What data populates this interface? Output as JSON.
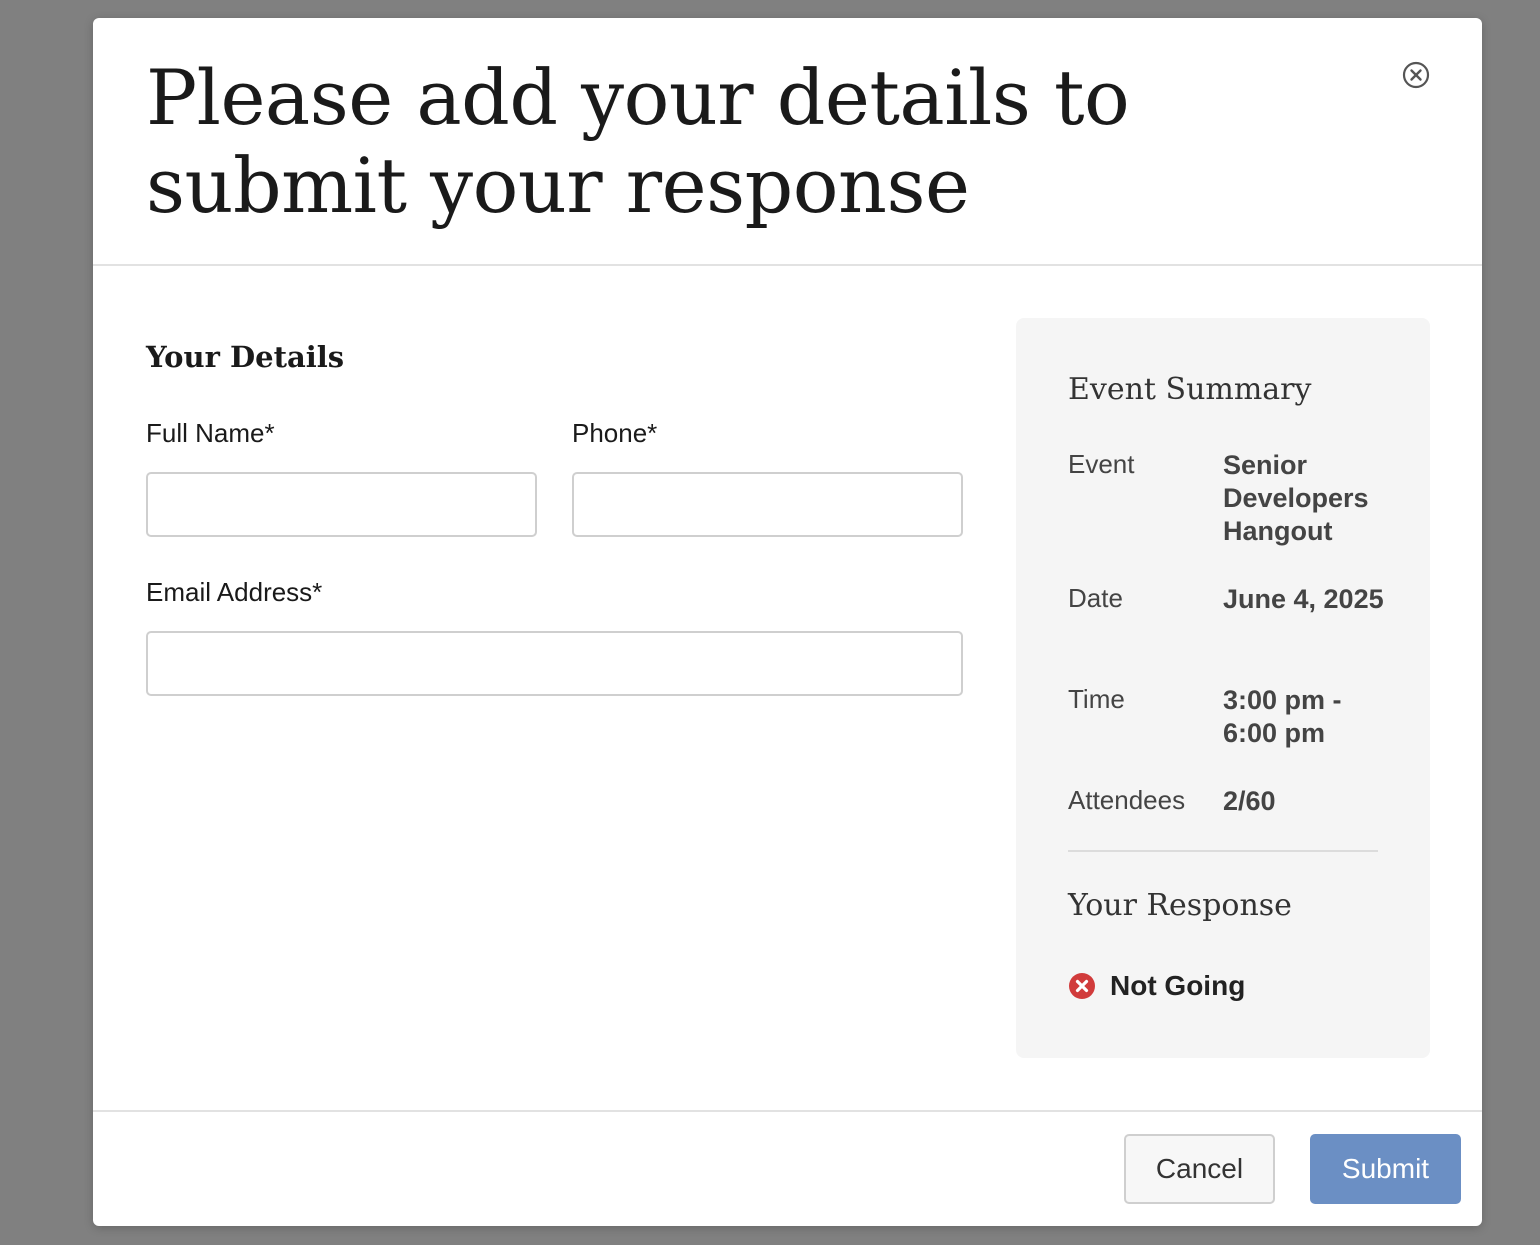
{
  "modal": {
    "title": "Please add your details to submit your response"
  },
  "form": {
    "section_title": "Your Details",
    "full_name": {
      "label": "Full Name*",
      "value": ""
    },
    "phone": {
      "label": "Phone*",
      "value": ""
    },
    "email": {
      "label": "Email Address*",
      "value": ""
    }
  },
  "summary": {
    "title": "Event Summary",
    "rows": [
      {
        "label": "Event",
        "value": "Senior Developers Hangout"
      },
      {
        "label": "Date",
        "value": "June 4, 2025"
      },
      {
        "label": "Time",
        "value": "3:00 pm - 6:00 pm"
      },
      {
        "label": "Attendees",
        "value": "2/60"
      }
    ],
    "response_title": "Your Response",
    "response_status": "Not Going",
    "status_color": "#d13b3b"
  },
  "footer": {
    "cancel_label": "Cancel",
    "submit_label": "Submit"
  },
  "colors": {
    "accent": "#6b8fc4",
    "overlay": "#808080"
  }
}
